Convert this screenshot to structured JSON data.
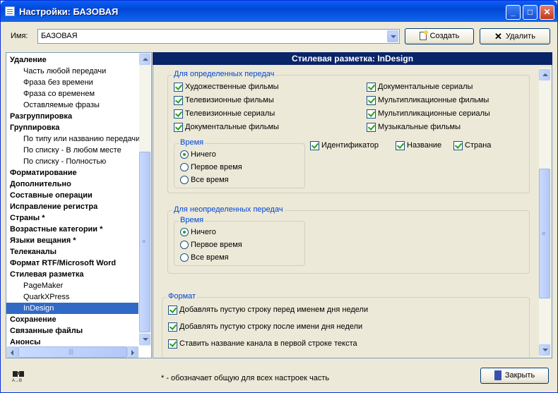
{
  "window": {
    "title": "Настройки: БАЗОВАЯ",
    "controls": [
      "_",
      "□",
      "✕"
    ]
  },
  "top": {
    "name_label": "Имя:",
    "name_value": "БАЗОВАЯ",
    "create_label": "Создать",
    "delete_label": "Удалить"
  },
  "tree": {
    "items": [
      {
        "label": "Удаление",
        "level": 0
      },
      {
        "label": "Часть любой передачи",
        "level": 1
      },
      {
        "label": "Фраза без времени",
        "level": 1
      },
      {
        "label": "Фраза со временем",
        "level": 1
      },
      {
        "label": "Оставляемые фразы",
        "level": 1
      },
      {
        "label": "Разгруппировка",
        "level": 0
      },
      {
        "label": "Группировка",
        "level": 0
      },
      {
        "label": "По типу или названию передачи",
        "level": 1
      },
      {
        "label": "По списку - В любом месте",
        "level": 1
      },
      {
        "label": "По списку - Полностью",
        "level": 1
      },
      {
        "label": "Форматирование",
        "level": 0
      },
      {
        "label": "Дополнительно",
        "level": 0
      },
      {
        "label": "Составные операции",
        "level": 0
      },
      {
        "label": "Исправление регистра",
        "level": 0
      },
      {
        "label": "Страны *",
        "level": 0
      },
      {
        "label": "Возрастные категории *",
        "level": 0
      },
      {
        "label": "Языки вещания *",
        "level": 0
      },
      {
        "label": "Телеканалы",
        "level": 0
      },
      {
        "label": "Формат RTF/Microsoft Word",
        "level": 0
      },
      {
        "label": "Стилевая разметка",
        "level": 0
      },
      {
        "label": "PageMaker",
        "level": 1
      },
      {
        "label": "QuarkXPress",
        "level": 1
      },
      {
        "label": "InDesign",
        "level": 1,
        "selected": true
      },
      {
        "label": "Сохранение",
        "level": 0
      },
      {
        "label": "Связанные файлы",
        "level": 0
      },
      {
        "label": "Анонсы",
        "level": 0
      }
    ]
  },
  "panel": {
    "header": "Стилевая разметка: InDesign",
    "defined": {
      "title": "Для определенных передач",
      "col1": [
        "Художественные фильмы",
        "Телевизионные фильмы",
        "Телевизионные сериалы",
        "Документальные фильмы"
      ],
      "col2": [
        "Документальные сериалы",
        "Мультипликационные фильмы",
        "Мультипликационные сериалы",
        "Музыкальные фильмы"
      ],
      "time_title": "Время",
      "time_options": [
        "Ничего",
        "Первое время",
        "Все время"
      ],
      "extras": [
        "Идентификатор",
        "Название",
        "Страна"
      ]
    },
    "undefined": {
      "title": "Для неопределенных передач",
      "time_title": "Время",
      "time_options": [
        "Ничего",
        "Первое время",
        "Все время"
      ]
    },
    "format": {
      "title": "Формат",
      "options": [
        "Добавлять пустую строку перед именем дня недели",
        "Добавлять пустую строку после имени дня недели",
        "Ставить название канала в первой строке текста"
      ]
    }
  },
  "footer": {
    "note": "* - обозначает общую для всех настроек часть",
    "close_label": "Закрыть"
  },
  "colors": {
    "title_bar": "#0a5ff7",
    "panel_header": "#0a246a",
    "selection": "#316ac5",
    "group_title": "#0046d5",
    "check": "#21a121"
  }
}
